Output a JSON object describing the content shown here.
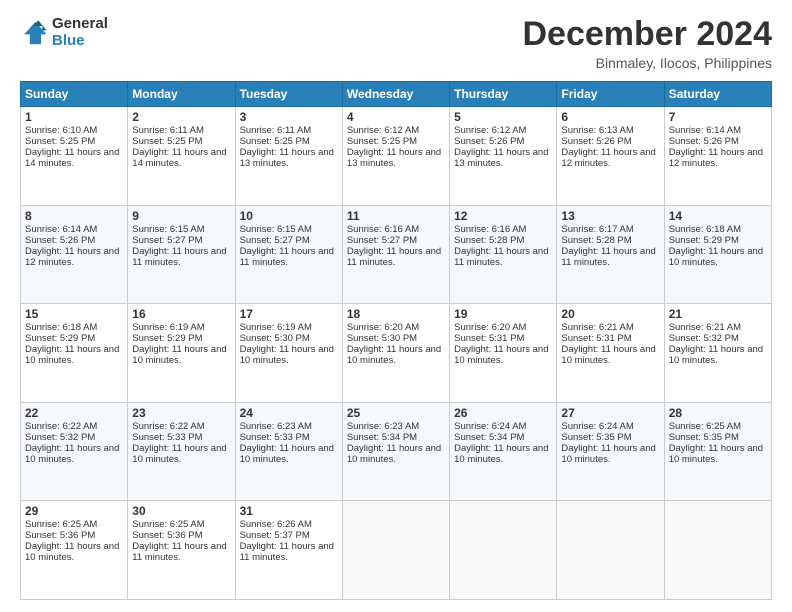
{
  "header": {
    "logo_general": "General",
    "logo_blue": "Blue",
    "month_title": "December 2024",
    "location": "Binmaley, Ilocos, Philippines"
  },
  "weekdays": [
    "Sunday",
    "Monday",
    "Tuesday",
    "Wednesday",
    "Thursday",
    "Friday",
    "Saturday"
  ],
  "weeks": [
    [
      {
        "day": "1",
        "sunrise": "6:10 AM",
        "sunset": "5:25 PM",
        "daylight": "11 hours and 14 minutes."
      },
      {
        "day": "2",
        "sunrise": "6:11 AM",
        "sunset": "5:25 PM",
        "daylight": "11 hours and 14 minutes."
      },
      {
        "day": "3",
        "sunrise": "6:11 AM",
        "sunset": "5:25 PM",
        "daylight": "11 hours and 13 minutes."
      },
      {
        "day": "4",
        "sunrise": "6:12 AM",
        "sunset": "5:25 PM",
        "daylight": "11 hours and 13 minutes."
      },
      {
        "day": "5",
        "sunrise": "6:12 AM",
        "sunset": "5:26 PM",
        "daylight": "11 hours and 13 minutes."
      },
      {
        "day": "6",
        "sunrise": "6:13 AM",
        "sunset": "5:26 PM",
        "daylight": "11 hours and 12 minutes."
      },
      {
        "day": "7",
        "sunrise": "6:14 AM",
        "sunset": "5:26 PM",
        "daylight": "11 hours and 12 minutes."
      }
    ],
    [
      {
        "day": "8",
        "sunrise": "6:14 AM",
        "sunset": "5:26 PM",
        "daylight": "11 hours and 12 minutes."
      },
      {
        "day": "9",
        "sunrise": "6:15 AM",
        "sunset": "5:27 PM",
        "daylight": "11 hours and 11 minutes."
      },
      {
        "day": "10",
        "sunrise": "6:15 AM",
        "sunset": "5:27 PM",
        "daylight": "11 hours and 11 minutes."
      },
      {
        "day": "11",
        "sunrise": "6:16 AM",
        "sunset": "5:27 PM",
        "daylight": "11 hours and 11 minutes."
      },
      {
        "day": "12",
        "sunrise": "6:16 AM",
        "sunset": "5:28 PM",
        "daylight": "11 hours and 11 minutes."
      },
      {
        "day": "13",
        "sunrise": "6:17 AM",
        "sunset": "5:28 PM",
        "daylight": "11 hours and 11 minutes."
      },
      {
        "day": "14",
        "sunrise": "6:18 AM",
        "sunset": "5:29 PM",
        "daylight": "11 hours and 10 minutes."
      }
    ],
    [
      {
        "day": "15",
        "sunrise": "6:18 AM",
        "sunset": "5:29 PM",
        "daylight": "11 hours and 10 minutes."
      },
      {
        "day": "16",
        "sunrise": "6:19 AM",
        "sunset": "5:29 PM",
        "daylight": "11 hours and 10 minutes."
      },
      {
        "day": "17",
        "sunrise": "6:19 AM",
        "sunset": "5:30 PM",
        "daylight": "11 hours and 10 minutes."
      },
      {
        "day": "18",
        "sunrise": "6:20 AM",
        "sunset": "5:30 PM",
        "daylight": "11 hours and 10 minutes."
      },
      {
        "day": "19",
        "sunrise": "6:20 AM",
        "sunset": "5:31 PM",
        "daylight": "11 hours and 10 minutes."
      },
      {
        "day": "20",
        "sunrise": "6:21 AM",
        "sunset": "5:31 PM",
        "daylight": "11 hours and 10 minutes."
      },
      {
        "day": "21",
        "sunrise": "6:21 AM",
        "sunset": "5:32 PM",
        "daylight": "11 hours and 10 minutes."
      }
    ],
    [
      {
        "day": "22",
        "sunrise": "6:22 AM",
        "sunset": "5:32 PM",
        "daylight": "11 hours and 10 minutes."
      },
      {
        "day": "23",
        "sunrise": "6:22 AM",
        "sunset": "5:33 PM",
        "daylight": "11 hours and 10 minutes."
      },
      {
        "day": "24",
        "sunrise": "6:23 AM",
        "sunset": "5:33 PM",
        "daylight": "11 hours and 10 minutes."
      },
      {
        "day": "25",
        "sunrise": "6:23 AM",
        "sunset": "5:34 PM",
        "daylight": "11 hours and 10 minutes."
      },
      {
        "day": "26",
        "sunrise": "6:24 AM",
        "sunset": "5:34 PM",
        "daylight": "11 hours and 10 minutes."
      },
      {
        "day": "27",
        "sunrise": "6:24 AM",
        "sunset": "5:35 PM",
        "daylight": "11 hours and 10 minutes."
      },
      {
        "day": "28",
        "sunrise": "6:25 AM",
        "sunset": "5:35 PM",
        "daylight": "11 hours and 10 minutes."
      }
    ],
    [
      {
        "day": "29",
        "sunrise": "6:25 AM",
        "sunset": "5:36 PM",
        "daylight": "11 hours and 10 minutes."
      },
      {
        "day": "30",
        "sunrise": "6:25 AM",
        "sunset": "5:36 PM",
        "daylight": "11 hours and 11 minutes."
      },
      {
        "day": "31",
        "sunrise": "6:26 AM",
        "sunset": "5:37 PM",
        "daylight": "11 hours and 11 minutes."
      },
      null,
      null,
      null,
      null
    ]
  ]
}
